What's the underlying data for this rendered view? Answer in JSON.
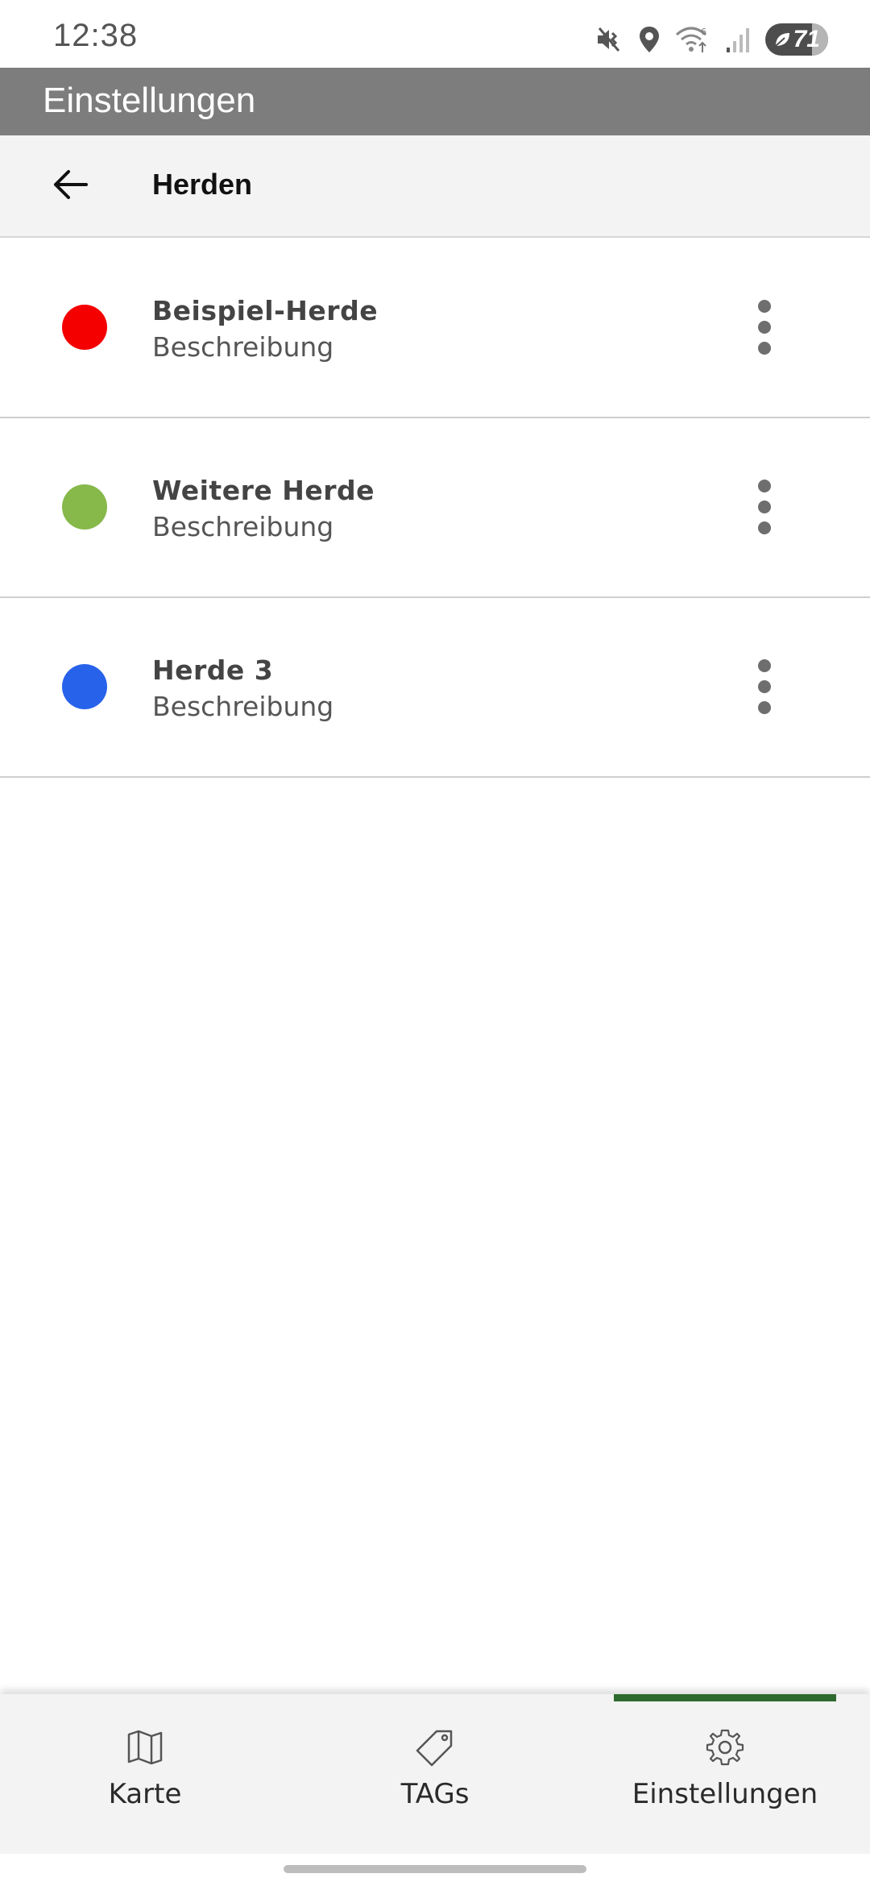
{
  "status_bar": {
    "time": "12:38",
    "battery": "71",
    "icons": [
      "mute-vibrate-icon",
      "location-icon",
      "wifi-icon",
      "signal-icon",
      "battery-icon"
    ]
  },
  "app_bar": {
    "title": "Einstellungen"
  },
  "header": {
    "title": "Herden",
    "back_icon": "arrow-left-icon"
  },
  "herds": [
    {
      "name": "Beispiel-Herde",
      "description": "Beschreibung",
      "color": "#f40000"
    },
    {
      "name": "Weitere Herde",
      "description": "Beschreibung",
      "color": "#86b84a"
    },
    {
      "name": "Herde 3",
      "description": "Beschreibung",
      "color": "#2762ea"
    }
  ],
  "bottom_nav": {
    "active": "Einstellungen",
    "accent": "#2e6a2f",
    "items": [
      {
        "label": "Karte",
        "icon": "map-icon"
      },
      {
        "label": "TAGs",
        "icon": "tag-icon"
      },
      {
        "label": "Einstellungen",
        "icon": "gear-icon"
      }
    ]
  }
}
